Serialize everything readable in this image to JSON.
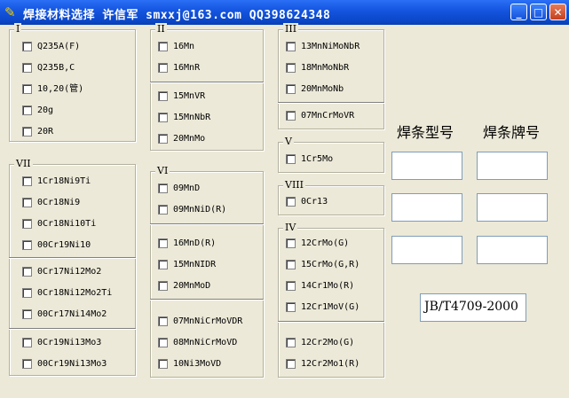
{
  "window": {
    "title": "焊接材料选择   许信军  smxxj@163.com   QQ398624348",
    "icon": "pencil-icon",
    "controls": {
      "minimize": "_",
      "maximize": "□",
      "close": "✕"
    }
  },
  "groups": {
    "I": {
      "legend": "I",
      "items": [
        "Q235A(F)",
        "Q235B,C",
        "10,20(管)",
        "20g",
        "20R"
      ]
    },
    "II": {
      "legend": "II",
      "items": [
        "16Mn",
        "16MnR",
        "15MnVR",
        "15MnNbR",
        "20MnMo"
      ]
    },
    "III": {
      "legend": "III",
      "items": [
        "13MnNiMoNbR",
        "18MnMoNbR",
        "20MnMoNb",
        "07MnCrMoVR"
      ]
    },
    "V": {
      "legend": "V",
      "items": [
        "1Cr5Mo"
      ]
    },
    "VIII": {
      "legend": "VIII",
      "items": [
        "0Cr13"
      ]
    },
    "IV": {
      "legend": "IV",
      "items": [
        "12CrMo(G)",
        "15CrMo(G,R)",
        "14Cr1Mo(R)",
        "12Cr1MoV(G)",
        "12Cr2Mo(G)",
        "12Cr2Mo1(R)"
      ]
    },
    "VII": {
      "legend": "VII",
      "items": [
        "1Cr18Ni9Ti",
        "0Cr18Ni9",
        "0Cr18Ni10Ti",
        "00Cr19Ni10",
        "0Cr17Ni12Mo2",
        "0Cr18Ni12Mo2Ti",
        "00Cr17Ni14Mo2",
        "0Cr19Ni13Mo3",
        "00Cr19Ni13Mo3"
      ]
    },
    "VI": {
      "legend": "VI",
      "items": [
        "09MnD",
        "09MnNiD(R)",
        "16MnD(R)",
        "15MnNIDR",
        "20MnMoD",
        "07MnNiCrMoVDR",
        "08MnNiCrMoVD",
        "10Ni3MoVD"
      ]
    }
  },
  "result": {
    "type_header": "焊条型号",
    "brand_header": "焊条牌号",
    "type_values": [
      "",
      "",
      ""
    ],
    "brand_values": [
      "",
      "",
      ""
    ],
    "standard": "JB/T4709-2000"
  }
}
